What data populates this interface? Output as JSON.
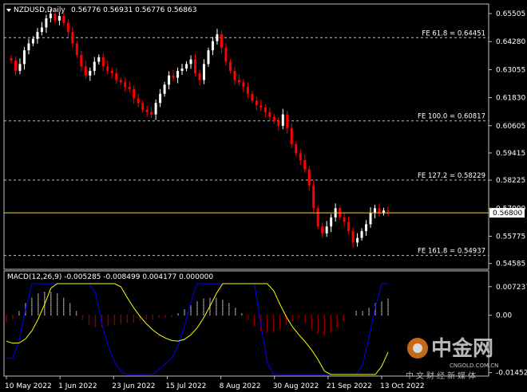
{
  "header": {
    "symbol": "NZDUSD,Daily",
    "values": "0.56776 0.56931 0.56776 0.56863"
  },
  "price_axis": {
    "ticks": [
      "0.65505",
      "0.64280",
      "0.63055",
      "0.61830",
      "0.60605",
      "0.59415",
      "0.58225",
      "0.57000",
      "0.55775",
      "0.54585"
    ],
    "current_price": "0.56800"
  },
  "fib_levels": [
    {
      "label": "FE 61.8 = 0.64451",
      "price": 0.64451
    },
    {
      "label": "FE 100.0 = 0.60817",
      "price": 0.60817
    },
    {
      "label": "FE 127.2 = 0.58229",
      "price": 0.58229
    },
    {
      "label": "FE 161.8 = 0.54937",
      "price": 0.54937
    }
  ],
  "macd": {
    "label": "MACD(12,26,9) -0.005285 -0.008499 0.004177 0.000000",
    "ticks": [
      "0.007237",
      "0.00",
      "-0.014529"
    ]
  },
  "time_axis": [
    "10 May 2022",
    "1 Jun 2022",
    "23 Jun 2022",
    "15 Jul 2022",
    "8 Aug 2022",
    "30 Aug 2022",
    "21 Sep 2022",
    "13 Oct 2022"
  ],
  "watermark": {
    "brand_cn": "中金网",
    "domain": "CNGOLD.COM.CN",
    "tagline": "中文财经新媒体"
  },
  "colors": {
    "up_candle": "#ffffff",
    "down_candle": "#ff0000",
    "fib_line": "#c0c0c0",
    "price_line": "#ffd700",
    "macd_line": "#0000ff",
    "signal_line": "#ffff00",
    "hist_up": "#ffffff",
    "hist_down": "#ff0000"
  },
  "chart_data": {
    "type": "candlestick",
    "series": [
      {
        "name": "NZDUSD,Daily",
        "close": [
          0.6345,
          0.63,
          0.633,
          0.639,
          0.642,
          0.644,
          0.647,
          0.649,
          0.653,
          0.655,
          0.652,
          0.654,
          0.651,
          0.647,
          0.642,
          0.637,
          0.632,
          0.628,
          0.63,
          0.634,
          0.636,
          0.632,
          0.63,
          0.629,
          0.626,
          0.625,
          0.623,
          0.622,
          0.618,
          0.616,
          0.613,
          0.612,
          0.611,
          0.616,
          0.62,
          0.624,
          0.628,
          0.627,
          0.63,
          0.631,
          0.633,
          0.635,
          0.629,
          0.626,
          0.633,
          0.639,
          0.643,
          0.646,
          0.64,
          0.634,
          0.63,
          0.626,
          0.625,
          0.623,
          0.62,
          0.617,
          0.615,
          0.614,
          0.612,
          0.61,
          0.608,
          0.606,
          0.611,
          0.605,
          0.598,
          0.594,
          0.591,
          0.587,
          0.58,
          0.57,
          0.562,
          0.559,
          0.562,
          0.566,
          0.57,
          0.566,
          0.564,
          0.56,
          0.555,
          0.557,
          0.56,
          0.563,
          0.568,
          0.57,
          0.568,
          0.569,
          0.5686
        ]
      },
      {
        "name": "MACD(12,26,9)",
        "histogram": [
          -0.002,
          -0.001,
          0.001,
          0.003,
          0.0045,
          0.0055,
          0.006,
          0.006,
          0.0055,
          0.0045,
          0.003,
          0.001,
          -0.001,
          -0.0025,
          -0.003,
          -0.003,
          -0.0028,
          -0.0025,
          -0.0022,
          -0.002,
          -0.0018,
          -0.0015,
          -0.0012,
          -0.001,
          -0.0008,
          -0.0006,
          -0.0005,
          0.0005,
          0.0015,
          0.0025,
          0.0035,
          0.0042,
          0.0045,
          0.0045,
          0.004,
          0.0032,
          0.002,
          0.0005,
          -0.0012,
          -0.0028,
          -0.004,
          -0.0045,
          -0.0042,
          -0.0035,
          -0.0025,
          -0.0015,
          -0.0008,
          -0.002,
          -0.0035,
          -0.0048,
          -0.0052,
          -0.0045,
          -0.003,
          -0.0015,
          0.0,
          0.0012,
          0.001,
          0.002,
          0.003,
          0.0035,
          0.0042
        ]
      }
    ],
    "ylim": [
      0.544,
      0.6575
    ],
    "macd_ylim": [
      -0.015,
      0.008
    ]
  }
}
